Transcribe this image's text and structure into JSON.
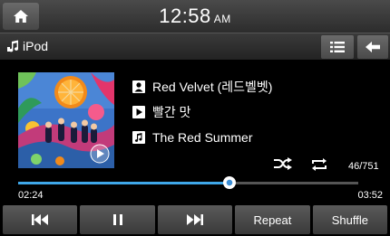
{
  "status_bar": {
    "time": "12:58",
    "ampm": "AM",
    "home_icon": "home-icon"
  },
  "source_bar": {
    "source_label": "iPod",
    "source_icon": "music-note-icon",
    "list_icon": "list-icon",
    "back_icon": "back-arrow-icon"
  },
  "now_playing": {
    "artist": "Red Velvet (레드벨벳)",
    "title": "빨간 맛",
    "album": "The Red Summer",
    "track_count": "46/751"
  },
  "progress": {
    "elapsed": "02:24",
    "total": "03:52",
    "fraction": 0.62
  },
  "controls": {
    "repeat_label": "Repeat",
    "shuffle_label": "Shuffle"
  },
  "colors": {
    "accent": "#3fa7e8",
    "button_bg": "#4a4a4a"
  }
}
